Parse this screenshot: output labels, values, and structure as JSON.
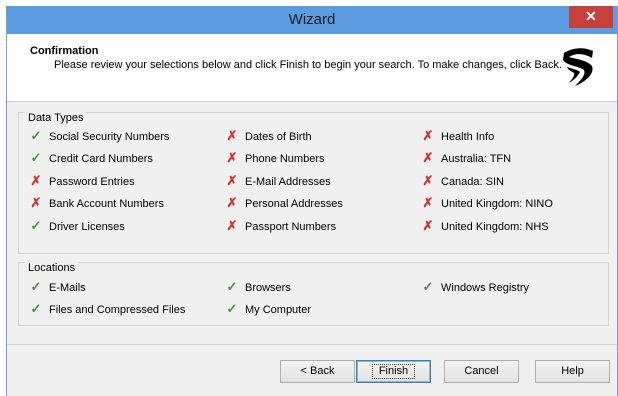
{
  "window": {
    "title": "Wizard",
    "close_label": "✕"
  },
  "header": {
    "title": "Confirmation",
    "description": "Please review your selections below and click Finish to begin your search.  To make changes, click Back."
  },
  "data_types": {
    "title": "Data Types",
    "columns": [
      [
        {
          "label": "Social Security Numbers",
          "status": "check"
        },
        {
          "label": "Credit Card Numbers",
          "status": "check"
        },
        {
          "label": "Password Entries",
          "status": "cross"
        },
        {
          "label": "Bank Account Numbers",
          "status": "cross"
        },
        {
          "label": "Driver Licenses",
          "status": "check"
        }
      ],
      [
        {
          "label": "Dates of Birth",
          "status": "cross"
        },
        {
          "label": "Phone Numbers",
          "status": "cross"
        },
        {
          "label": "E-Mail Addresses",
          "status": "cross"
        },
        {
          "label": "Personal Addresses",
          "status": "cross"
        },
        {
          "label": "Passport Numbers",
          "status": "cross"
        }
      ],
      [
        {
          "label": "Health Info",
          "status": "cross"
        },
        {
          "label": "Australia: TFN",
          "status": "cross"
        },
        {
          "label": "Canada: SIN",
          "status": "cross"
        },
        {
          "label": "United Kingdom: NINO",
          "status": "cross"
        },
        {
          "label": "United Kingdom: NHS",
          "status": "cross"
        }
      ]
    ]
  },
  "locations": {
    "title": "Locations",
    "columns": [
      [
        {
          "label": "E-Mails",
          "status": "check"
        },
        {
          "label": "Files and Compressed Files",
          "status": "check"
        }
      ],
      [
        {
          "label": "Browsers",
          "status": "check"
        },
        {
          "label": "My Computer",
          "status": "check"
        }
      ],
      [
        {
          "label": "Windows Registry",
          "status": "check"
        }
      ]
    ]
  },
  "buttons": {
    "back": "< Back",
    "finish": "Finish",
    "cancel": "Cancel",
    "help": "Help"
  },
  "icons": {
    "check": "✓",
    "cross": "✗"
  },
  "colors": {
    "titlebar": "#5b9be0",
    "close": "#c7403a",
    "check": "#3a9a35",
    "cross": "#d6322a"
  }
}
